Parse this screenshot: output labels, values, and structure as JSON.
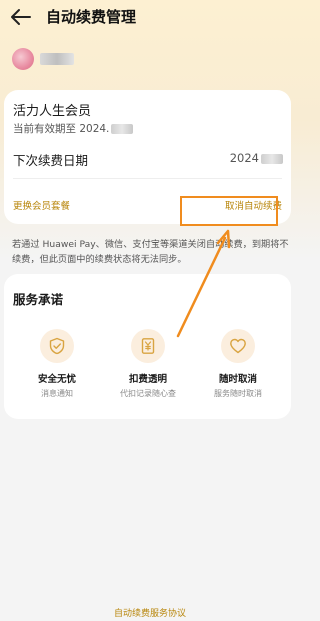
{
  "header": {
    "title": "自动续费管理"
  },
  "member": {
    "plan_name": "活力人生会员",
    "validity_prefix": "当前有效期至 2024.",
    "next_renewal_label": "下次续费日期",
    "next_renewal_value": "2024",
    "change_plan_label": "更换会员套餐",
    "cancel_label": "取消自动续费"
  },
  "notice": "若通过 Huawei Pay、微信、支付宝等渠道关闭自动续费，到期将不续费，但此页面中的续费状态将无法同步。",
  "service": {
    "title": "服务承诺",
    "items": [
      {
        "name": "安全无忧",
        "desc": "消息通知",
        "icon": "shield-check-icon"
      },
      {
        "name": "扣费透明",
        "desc": "代扣记录随心查",
        "icon": "yen-receipt-icon"
      },
      {
        "name": "随时取消",
        "desc": "服务随时取消",
        "icon": "heart-icon"
      }
    ]
  },
  "footer": {
    "agreement_label": "自动续费服务协议"
  },
  "colors": {
    "accent": "#b8860b",
    "annotation": "#f08c1e",
    "icon_bg": "#fbeede",
    "icon_stroke": "#d9a441"
  }
}
